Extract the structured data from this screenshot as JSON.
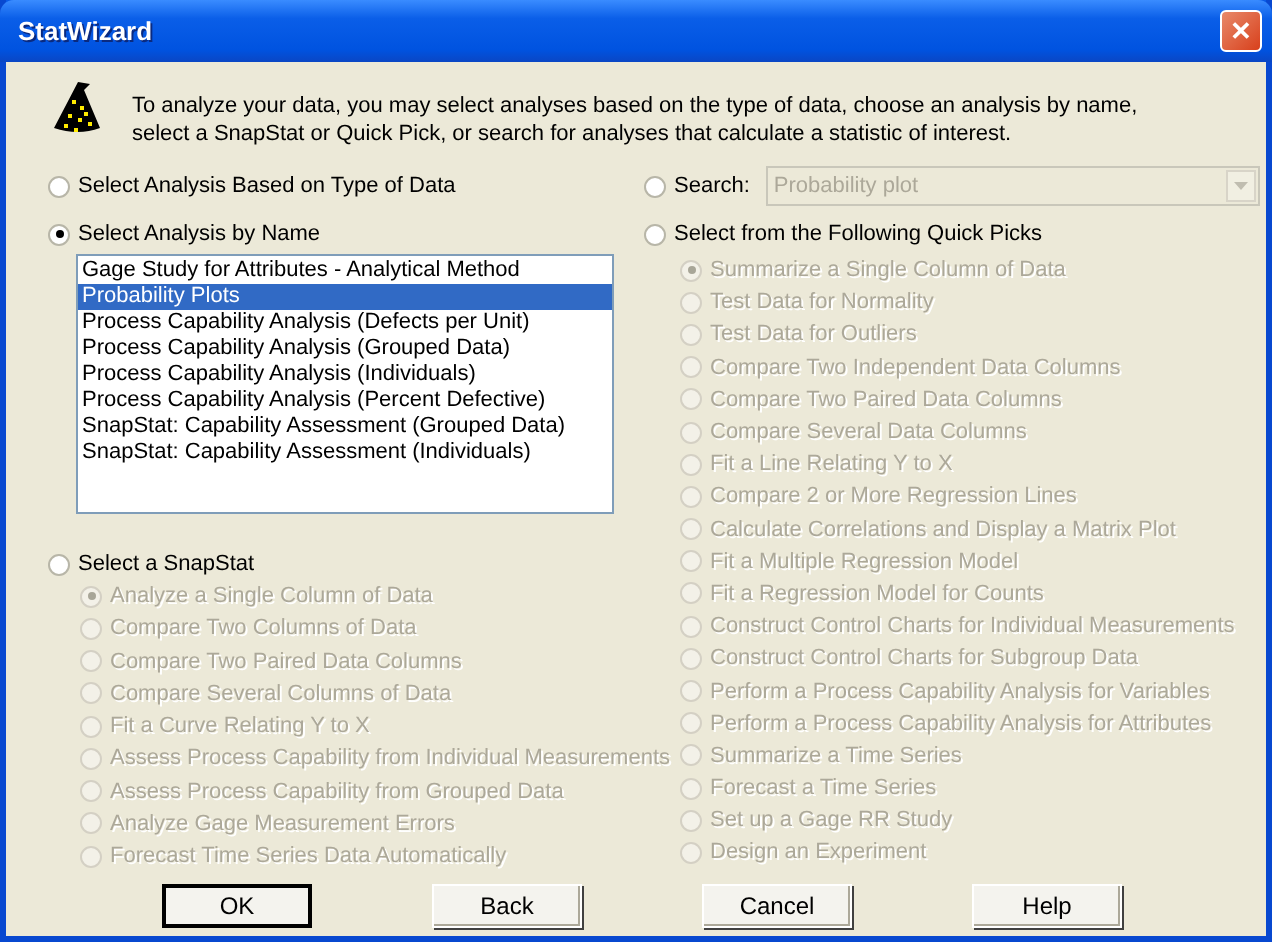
{
  "window": {
    "title": "StatWizard",
    "close": "✕"
  },
  "intro": "To analyze your data, you may select analyses based on the type of data, choose an analysis by name, select a SnapStat or Quick Pick, or search for analyses that calculate a statistic of interest.",
  "type_of_data": {
    "label": "Select Analysis Based on Type of Data",
    "selected": false
  },
  "by_name": {
    "label": "Select Analysis by Name",
    "selected": true,
    "items": [
      {
        "label": "Gage Study for Attributes - Analytical Method",
        "selected": false
      },
      {
        "label": "Probability Plots",
        "selected": true
      },
      {
        "label": "Process Capability Analysis (Defects per Unit)",
        "selected": false
      },
      {
        "label": "Process Capability Analysis (Grouped Data)",
        "selected": false
      },
      {
        "label": "Process Capability Analysis (Individuals)",
        "selected": false
      },
      {
        "label": "Process Capability Analysis (Percent Defective)",
        "selected": false
      },
      {
        "label": "SnapStat: Capability Assessment (Grouped Data)",
        "selected": false
      },
      {
        "label": "SnapStat: Capability Assessment (Individuals)",
        "selected": false
      }
    ]
  },
  "snapstat": {
    "label": "Select a SnapStat",
    "selected": false,
    "disabled": true,
    "choices": [
      {
        "label": "Analyze a Single Column of Data",
        "selected": true
      },
      {
        "label": "Compare Two Columns of Data",
        "selected": false
      },
      {
        "label": "Compare Two Paired Data Columns",
        "selected": false
      },
      {
        "label": "Compare Several Columns of Data",
        "selected": false
      },
      {
        "label": "Fit a Curve Relating Y to X",
        "selected": false
      },
      {
        "label": "Assess Process Capability from Individual Measurements",
        "selected": false
      },
      {
        "label": "Assess Process Capability from Grouped Data",
        "selected": false
      },
      {
        "label": "Analyze Gage Measurement Errors",
        "selected": false
      },
      {
        "label": "Forecast Time Series Data Automatically",
        "selected": false
      }
    ]
  },
  "search": {
    "label": "Search:",
    "selected": false,
    "disabled": true,
    "value": "Probability plot"
  },
  "quick_picks": {
    "label": "Select from the Following Quick Picks",
    "selected": false,
    "disabled": true,
    "choices": [
      {
        "label": "Summarize a Single Column of Data",
        "selected": true
      },
      {
        "label": "Test Data for Normality",
        "selected": false
      },
      {
        "label": "Test Data for Outliers",
        "selected": false
      },
      {
        "label": "Compare Two Independent Data Columns",
        "selected": false
      },
      {
        "label": "Compare Two Paired Data Columns",
        "selected": false
      },
      {
        "label": "Compare Several Data Columns",
        "selected": false
      },
      {
        "label": "Fit a Line Relating Y to X",
        "selected": false
      },
      {
        "label": "Compare 2 or More Regression Lines",
        "selected": false
      },
      {
        "label": "Calculate Correlations and Display a Matrix Plot",
        "selected": false
      },
      {
        "label": "Fit a Multiple Regression Model",
        "selected": false
      },
      {
        "label": "Fit a Regression Model for Counts",
        "selected": false
      },
      {
        "label": "Construct Control Charts for Individual Measurements",
        "selected": false
      },
      {
        "label": "Construct Control Charts for Subgroup Data",
        "selected": false
      },
      {
        "label": "Perform a Process Capability Analysis for Variables",
        "selected": false
      },
      {
        "label": "Perform a Process Capability Analysis for Attributes",
        "selected": false
      },
      {
        "label": "Summarize a Time Series",
        "selected": false
      },
      {
        "label": "Forecast a Time Series",
        "selected": false
      },
      {
        "label": "Set up a Gage RR Study",
        "selected": false
      },
      {
        "label": "Design an Experiment",
        "selected": false
      }
    ]
  },
  "buttons": [
    {
      "label": "OK",
      "default": true
    },
    {
      "label": "Back",
      "default": false
    },
    {
      "label": "Cancel",
      "default": false
    },
    {
      "label": "Help",
      "default": false
    }
  ]
}
